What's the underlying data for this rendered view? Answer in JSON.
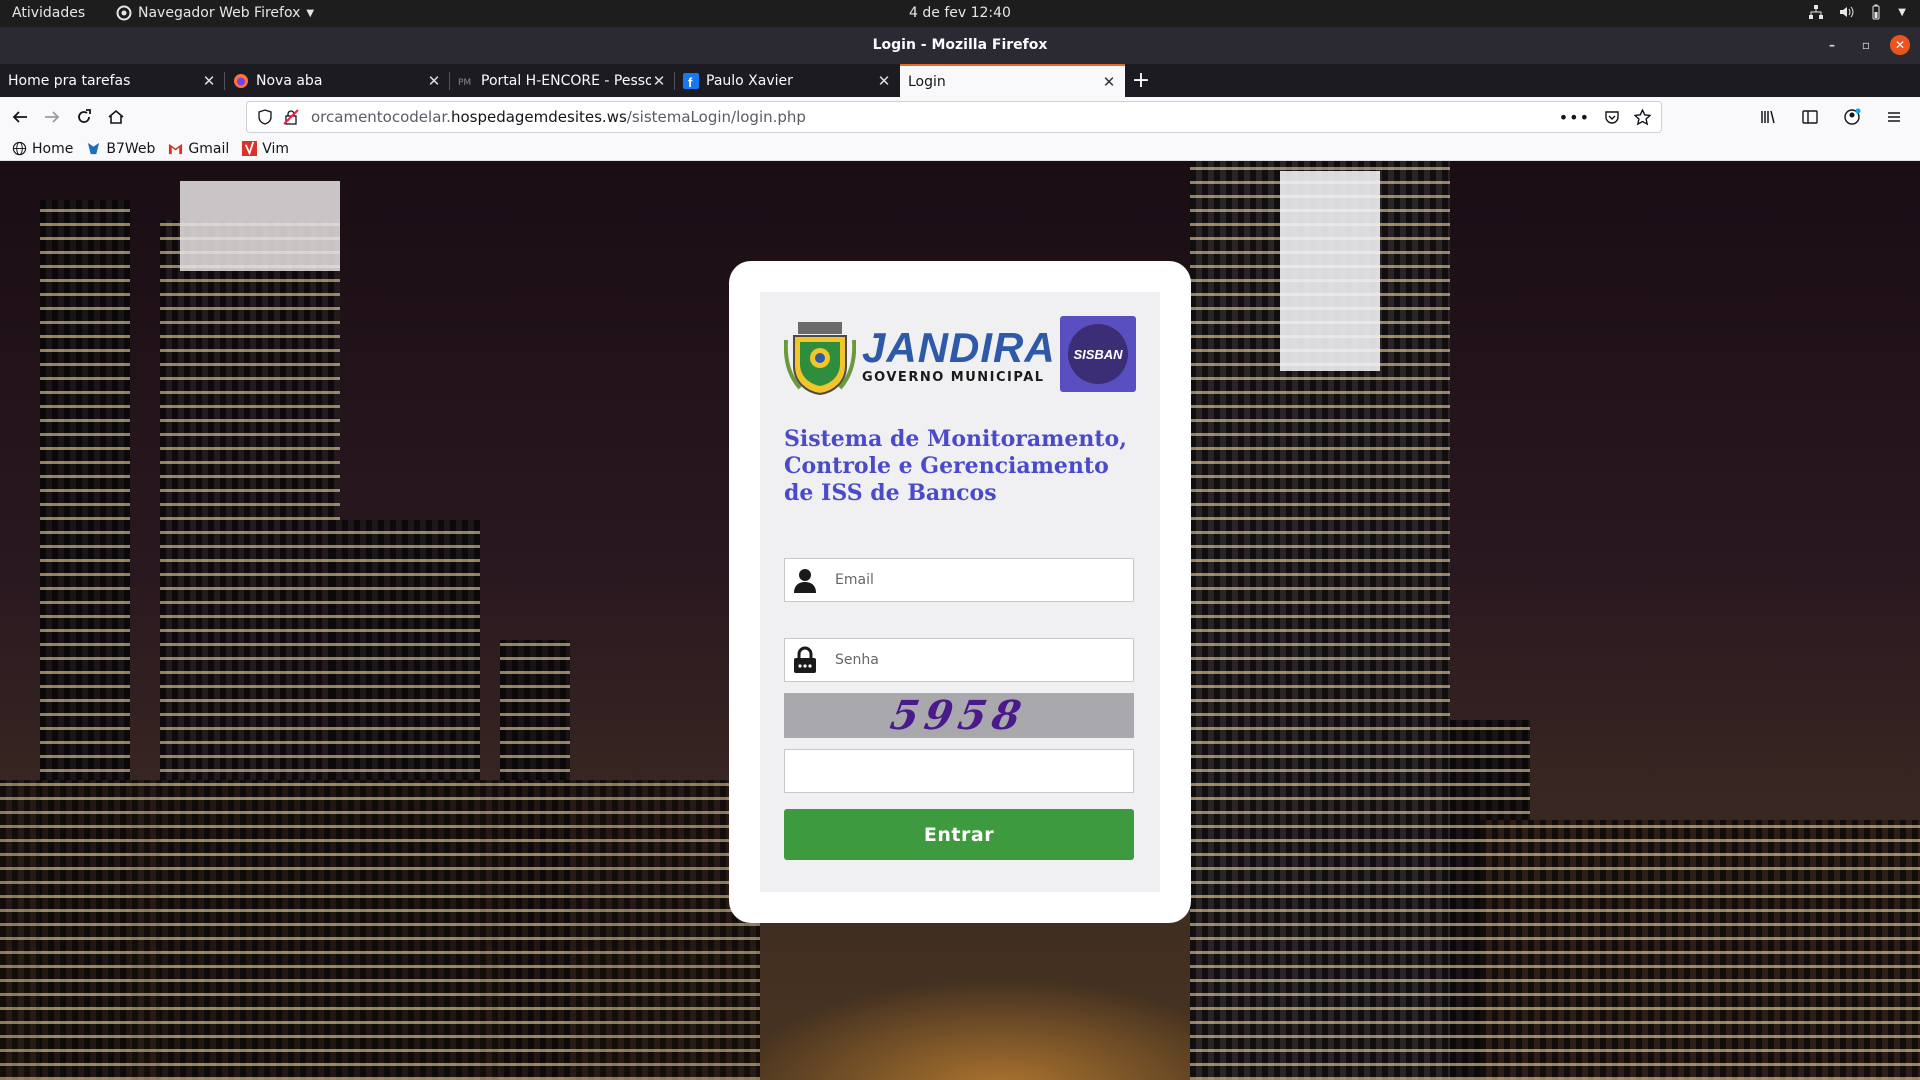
{
  "system_bar": {
    "activities": "Atividades",
    "app_menu": "Navegador Web Firefox",
    "clock": "4 de fev  12:40"
  },
  "window": {
    "title": "Login - Mozilla Firefox"
  },
  "tabs": [
    {
      "label": "Home pra tarefas",
      "favicon": "none"
    },
    {
      "label": "Nova aba",
      "favicon": "firefox-icon"
    },
    {
      "label": "Portal H-ENCORE - Pesso",
      "favicon": "pm-icon"
    },
    {
      "label": "Paulo Xavier",
      "favicon": "facebook-icon"
    },
    {
      "label": "Login",
      "favicon": "none",
      "active": true
    }
  ],
  "navbar": {
    "url_prefix": "orcamentocodelar.",
    "url_host": "hospedagemdesites.ws",
    "url_path": "/sistemaLogin/login.php"
  },
  "bookmarks": [
    {
      "label": "Home",
      "icon": "globe-icon"
    },
    {
      "label": "B7Web",
      "icon": "b7web-icon"
    },
    {
      "label": "Gmail",
      "icon": "gmail-icon"
    },
    {
      "label": "Vim",
      "icon": "vim-icon"
    }
  ],
  "login": {
    "brand_name": "JANDIRA",
    "brand_subtitle": "GOVERNO MUNICIPAL",
    "badge_text": "SISBAN",
    "system_title": "Sistema de Monitoramento, Controle e Gerenciamento de ISS de Bancos",
    "email_placeholder": "Email",
    "password_placeholder": "Senha",
    "captcha_text": "5958",
    "captcha_value": "",
    "submit_label": "Entrar"
  },
  "colors": {
    "brand_blue": "#2e58a8",
    "title_purple": "#4b4bc9",
    "submit_green": "#3d9a3f",
    "sisban_purple": "#5a4fc0",
    "tab_accent": "#e66a2c"
  }
}
